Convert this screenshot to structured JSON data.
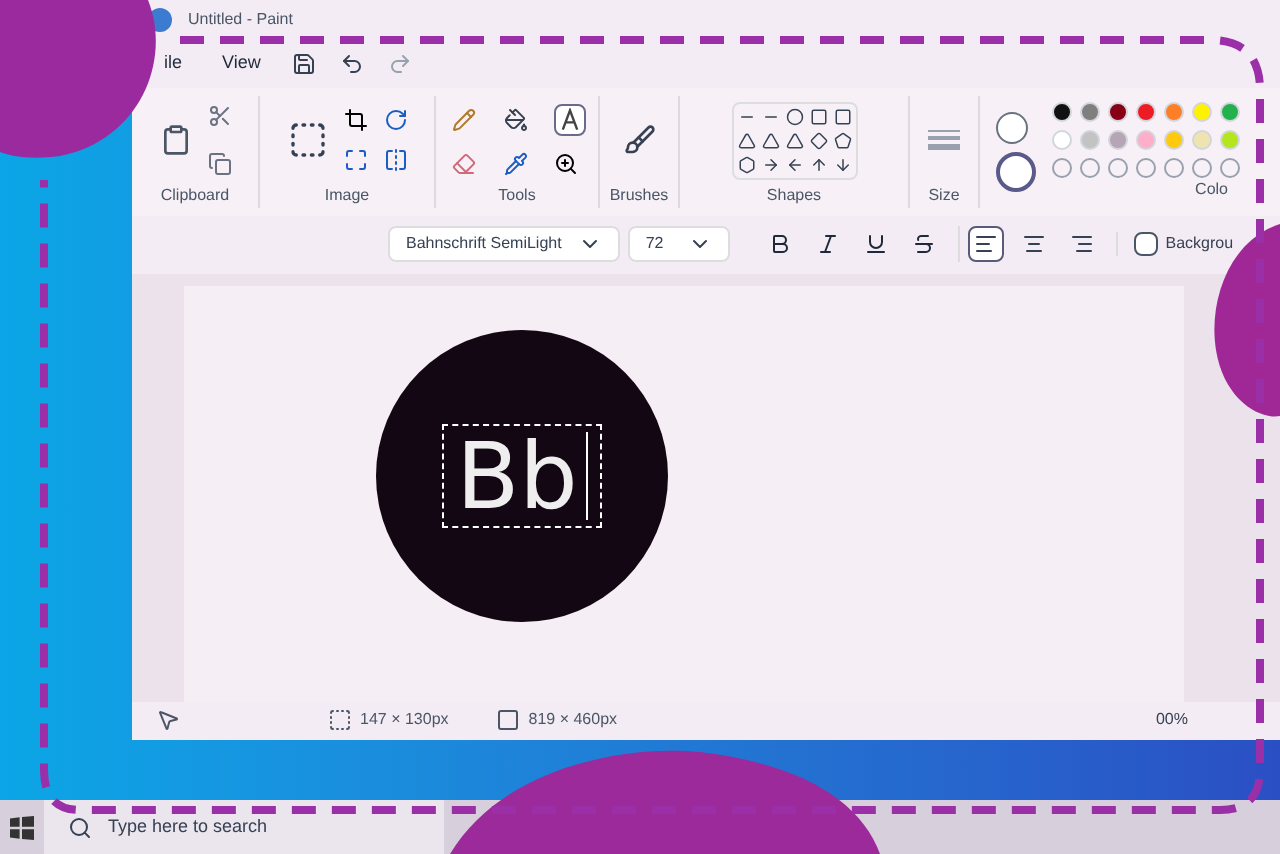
{
  "window": {
    "title": "Untitled - Paint"
  },
  "menu": [
    {
      "label": "ile"
    },
    {
      "label": "View"
    }
  ],
  "ribbon": {
    "groups": [
      "Clipboard",
      "Image",
      "Tools",
      "Brushes",
      "Shapes",
      "Size",
      "Colo"
    ],
    "text_tool_selected": true,
    "colors": [
      {
        "color": "#111111"
      },
      {
        "color": "#7f7f7f"
      },
      {
        "color": "#880015"
      },
      {
        "color": "#ed1c24"
      },
      {
        "color": "#ff7f27"
      },
      {
        "color": "#fff200"
      },
      {
        "color": "#22b14c"
      },
      {
        "color": "#ffffff"
      },
      {
        "color": "#c3c3c3"
      },
      {
        "color": "#b5a5b5"
      },
      {
        "color": "#ffaec9"
      },
      {
        "color": "#ffc90e"
      },
      {
        "color": "#efe4b0"
      },
      {
        "color": "#b5e61d"
      }
    ]
  },
  "text_toolbar": {
    "font": "Bahnschrift SemiLight",
    "size": "72",
    "format": [
      {
        "kind": "bold",
        "selected": false
      },
      {
        "kind": "italic",
        "selected": false
      },
      {
        "kind": "underline",
        "selected": false
      },
      {
        "kind": "strike",
        "selected": false
      }
    ],
    "align": [
      {
        "kind": "left",
        "selected": true
      },
      {
        "kind": "center",
        "selected": false
      },
      {
        "kind": "right",
        "selected": false
      }
    ],
    "background": {
      "label": "Backgrou",
      "checked": false
    }
  },
  "canvas": {
    "text": "Bb"
  },
  "status_bar": {
    "selection": "147 × 130px",
    "canvas_size": "819 × 460px",
    "zoom": "00%"
  },
  "taskbar": {
    "search": {
      "placeholder": "Type here to search"
    }
  }
}
